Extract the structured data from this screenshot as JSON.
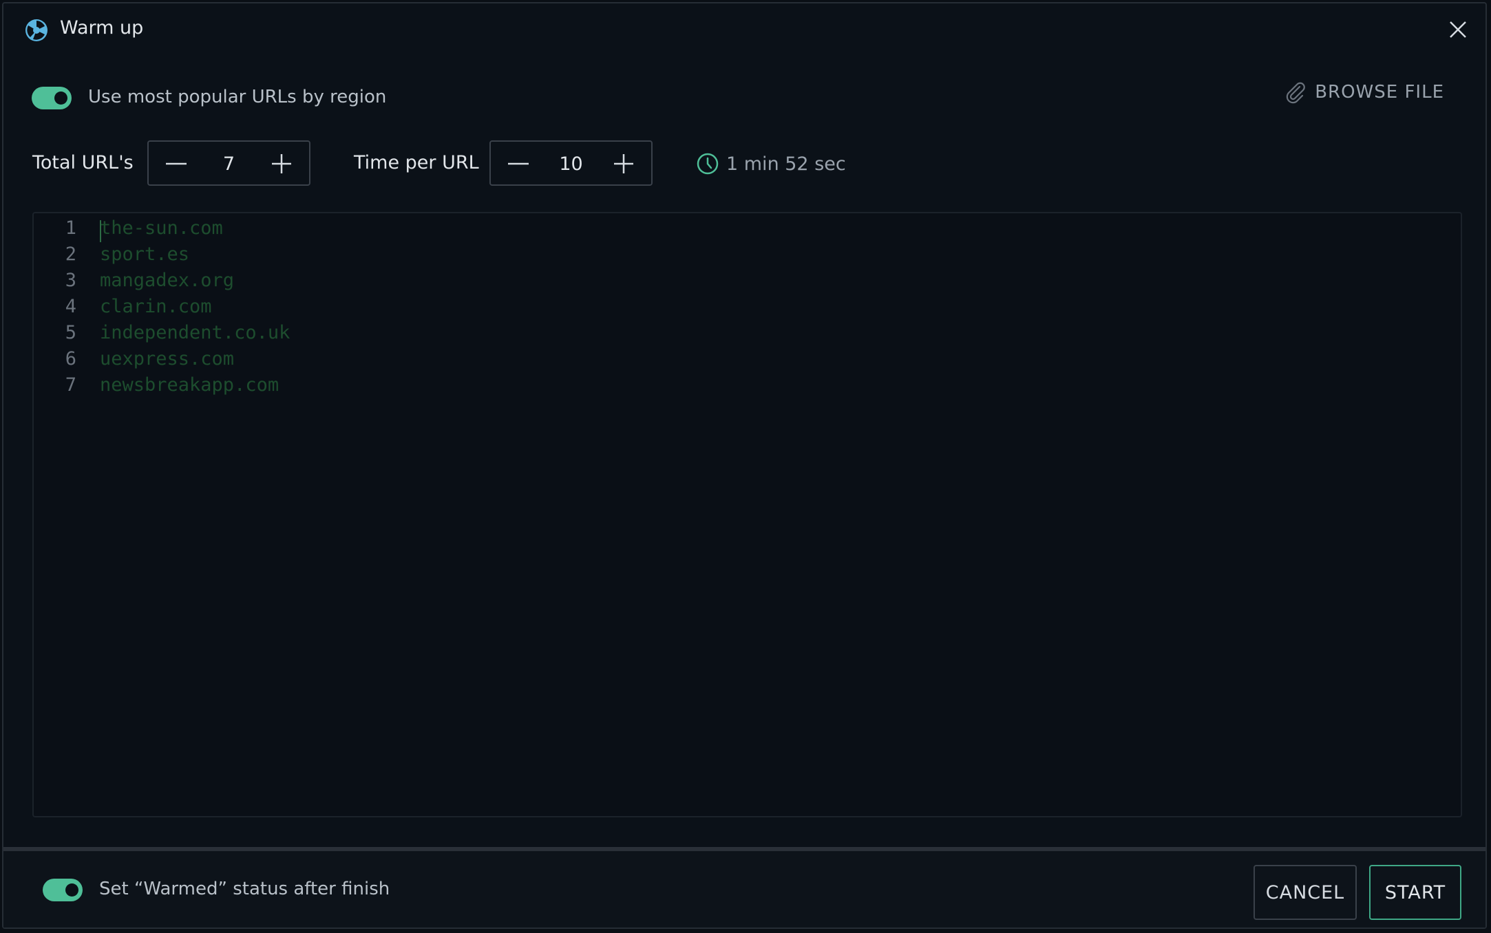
{
  "window": {
    "title": "Warm up"
  },
  "options": {
    "popular_urls_label": "Use most popular URLs by region",
    "popular_urls_enabled": true,
    "browse_label": "BROWSE FILE"
  },
  "settings": {
    "total_urls_label": "Total URL's",
    "total_urls_value": "7",
    "time_per_url_label": "Time per URL",
    "time_per_url_value": "10",
    "estimated_duration": "1 min 52 sec"
  },
  "editor": {
    "lines": [
      {
        "num": "1",
        "text": "the-sun.com"
      },
      {
        "num": "2",
        "text": "sport.es"
      },
      {
        "num": "3",
        "text": "mangadex.org"
      },
      {
        "num": "4",
        "text": "clarin.com"
      },
      {
        "num": "5",
        "text": "independent.co.uk"
      },
      {
        "num": "6",
        "text": "uexpress.com"
      },
      {
        "num": "7",
        "text": "newsbreakapp.com"
      }
    ]
  },
  "footer": {
    "warmed_status_label": "Set “Warmed” status after finish",
    "warmed_status_enabled": true,
    "cancel_label": "CANCEL",
    "start_label": "START"
  },
  "colors": {
    "accent": "#4fbf98",
    "background": "#0b1118",
    "url_text": "#1d4d2e"
  }
}
